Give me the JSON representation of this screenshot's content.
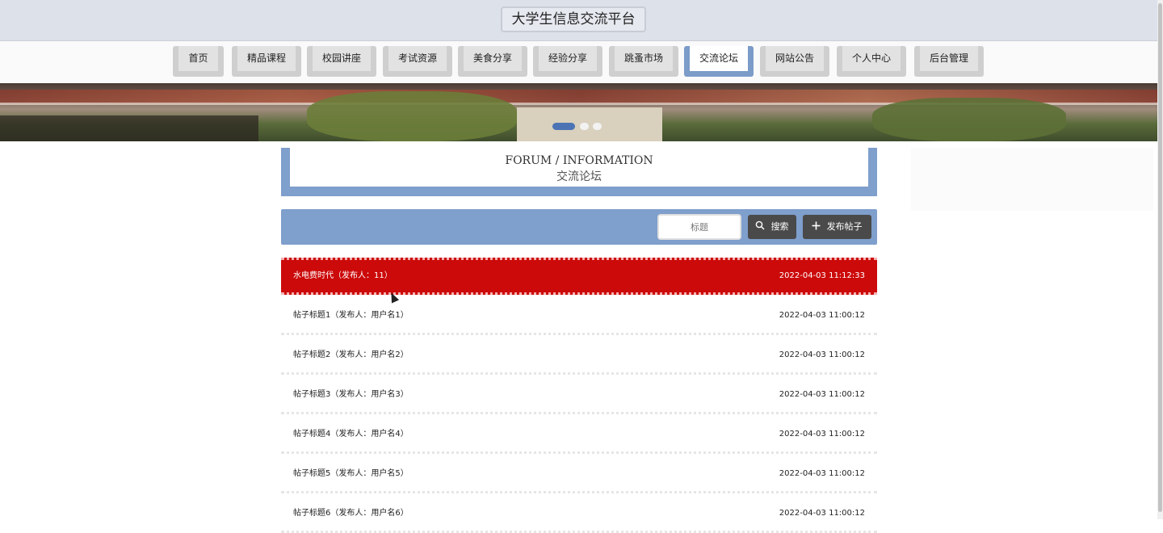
{
  "site": {
    "title": "大学生信息交流平台"
  },
  "nav": {
    "items": [
      {
        "label": "首页",
        "active": false
      },
      {
        "label": "精品课程",
        "active": false
      },
      {
        "label": "校园讲座",
        "active": false
      },
      {
        "label": "考试资源",
        "active": false
      },
      {
        "label": "美食分享",
        "active": false
      },
      {
        "label": "经验分享",
        "active": false
      },
      {
        "label": "跳蚤市场",
        "active": false
      },
      {
        "label": "交流论坛",
        "active": true
      },
      {
        "label": "网站公告",
        "active": false
      },
      {
        "label": "个人中心",
        "active": false
      },
      {
        "label": "后台管理",
        "active": false
      }
    ]
  },
  "banner": {
    "slide_count": 3,
    "active_slide": 1
  },
  "section": {
    "title_en": "FORUM / INFORMATION",
    "title_cn": "交流论坛"
  },
  "toolbar": {
    "search_placeholder": "标题",
    "search_label": "搜索",
    "post_label": "发布帖子"
  },
  "posts": [
    {
      "title": "水电费时代（发布人：11）",
      "time": "2022-04-03 11:12:33",
      "highlighted": true
    },
    {
      "title": "帖子标题1（发布人：用户名1）",
      "time": "2022-04-03 11:00:12",
      "highlighted": false
    },
    {
      "title": "帖子标题2（发布人：用户名2）",
      "time": "2022-04-03 11:00:12",
      "highlighted": false
    },
    {
      "title": "帖子标题3（发布人：用户名3）",
      "time": "2022-04-03 11:00:12",
      "highlighted": false
    },
    {
      "title": "帖子标题4（发布人：用户名4）",
      "time": "2022-04-03 11:00:12",
      "highlighted": false
    },
    {
      "title": "帖子标题5（发布人：用户名5）",
      "time": "2022-04-03 11:00:12",
      "highlighted": false
    },
    {
      "title": "帖子标题6（发布人：用户名6）",
      "time": "2022-04-03 11:00:12",
      "highlighted": false
    }
  ],
  "colors": {
    "accent": "#7f9fcc",
    "highlight": "#cc0a0a",
    "button": "#4a4a4a",
    "header_bg": "#dde1ea"
  },
  "icons": {
    "search": "search-icon",
    "add": "plus-icon"
  }
}
